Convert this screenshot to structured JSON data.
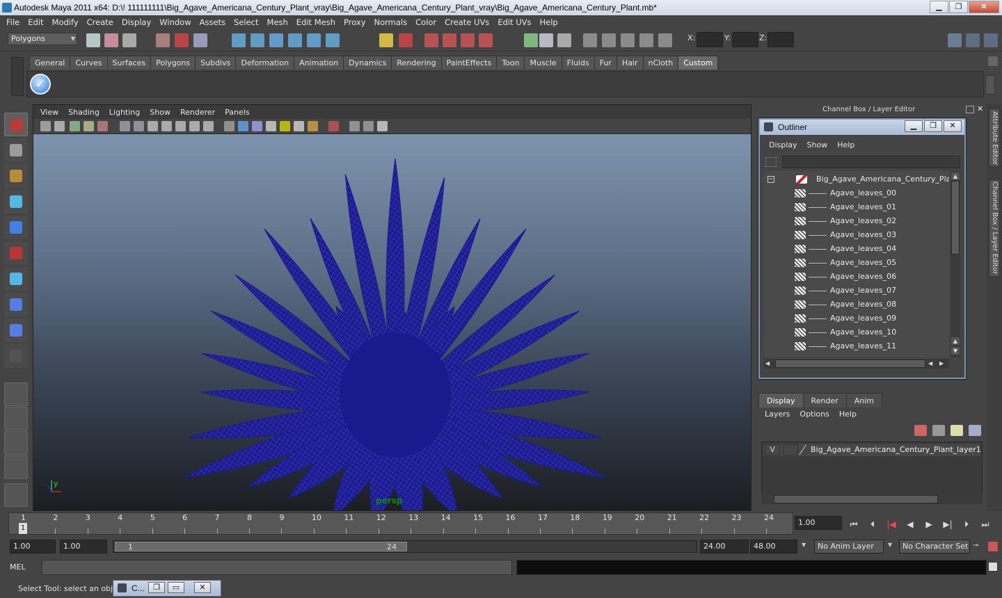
{
  "window": {
    "title": "Autodesk Maya 2011 x64: D:\\! 111111111\\Big_Agave_Americana_Century_Plant_vray\\Big_Agave_Americana_Century_Plant_vray\\Big_Agave_Americana_Century_Plant.mb*",
    "minimize": "▁",
    "maximize": "❐",
    "close": "✕"
  },
  "menubar": [
    "File",
    "Edit",
    "Modify",
    "Create",
    "Display",
    "Window",
    "Assets",
    "Select",
    "Mesh",
    "Edit Mesh",
    "Proxy",
    "Normals",
    "Color",
    "Create UVs",
    "Edit UVs",
    "Help"
  ],
  "statusline": {
    "mode": "Polygons",
    "x_label": "X:",
    "y_label": "Y:",
    "z_label": "Z:"
  },
  "shelf": {
    "tabs": [
      "General",
      "Curves",
      "Surfaces",
      "Polygons",
      "Subdivs",
      "Deformation",
      "Animation",
      "Dynamics",
      "Rendering",
      "PaintEffects",
      "Toon",
      "Muscle",
      "Fluids",
      "Fur",
      "Hair",
      "nCloth",
      "Custom"
    ],
    "active_tab": "Custom"
  },
  "viewport": {
    "menus": [
      "View",
      "Shading",
      "Lighting",
      "Show",
      "Renderer",
      "Panels"
    ],
    "camera_label": "persp",
    "mesh_color": "#1a1a8c"
  },
  "channel_box_header": "Channel Box / Layer Editor",
  "outliner": {
    "title": "Outliner",
    "menus": [
      "Display",
      "Show",
      "Help"
    ],
    "root": "Big_Agave_Americana_Century_Plant",
    "children": [
      "Agave_leaves_00",
      "Agave_leaves_01",
      "Agave_leaves_02",
      "Agave_leaves_03",
      "Agave_leaves_04",
      "Agave_leaves_05",
      "Agave_leaves_06",
      "Agave_leaves_07",
      "Agave_leaves_08",
      "Agave_leaves_09",
      "Agave_leaves_10",
      "Agave_leaves_11"
    ]
  },
  "side_tabs": [
    "Attribute Editor",
    "Channel Box / Layer Editor"
  ],
  "layer_editor": {
    "tabs": [
      "Display",
      "Render",
      "Anim"
    ],
    "active_tab": "Display",
    "menus": [
      "Layers",
      "Options",
      "Help"
    ],
    "layer_visibility": "V",
    "layer_name": "Big_Agave_Americana_Century_Plant_layer1"
  },
  "timeline": {
    "frames": [
      "1",
      "2",
      "3",
      "4",
      "5",
      "6",
      "7",
      "8",
      "9",
      "10",
      "11",
      "12",
      "13",
      "14",
      "15",
      "16",
      "17",
      "18",
      "19",
      "20",
      "21",
      "22",
      "23",
      "24"
    ],
    "current_marker": "1",
    "current_frame": "1.00"
  },
  "range": {
    "start_time": "1.00",
    "playback_start": "1.00",
    "range_start": "1",
    "range_end": "24",
    "playback_end": "24.00",
    "end_time": "48.00",
    "anim_layer": "No Anim Layer",
    "character_set": "No Character Set"
  },
  "command_line": {
    "label": "MEL"
  },
  "help_line": {
    "text": "Select Tool: select an object",
    "mini_window_title": "C..."
  }
}
